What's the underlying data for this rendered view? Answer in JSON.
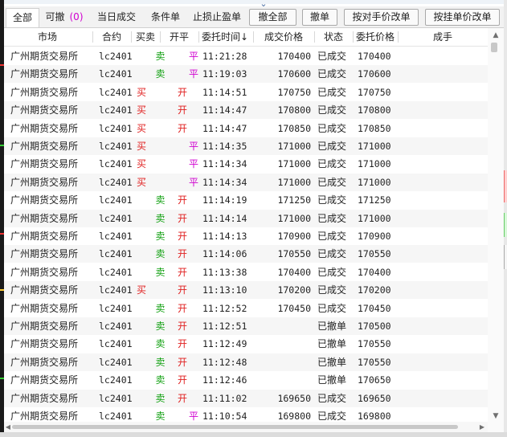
{
  "tabs": [
    {
      "label": "全部",
      "active": true
    },
    {
      "label": "可撤",
      "badge": "(0)",
      "active": false
    },
    {
      "label": "当日成交",
      "active": false
    },
    {
      "label": "条件单",
      "active": false
    },
    {
      "label": "止损止盈单",
      "active": false
    }
  ],
  "buttons": {
    "cancel_all": "撤全部",
    "cancel": "撤单",
    "modify_opposite": "按对手价改单",
    "modify_queue": "按挂单价改单"
  },
  "columns": {
    "market": "市场",
    "contract": "合约",
    "buy_sell": "买卖",
    "open_close": "开平",
    "order_time": "委托时间↓",
    "fill_price": "成交价格",
    "status": "状态",
    "order_price": "委托价格",
    "filled_lots": "成手"
  },
  "colors": {
    "buy": "#e02020",
    "sell": "#10a010",
    "open": "#e02020",
    "close": "#d000d0",
    "badge": "#d000d0"
  },
  "rows": [
    {
      "market": "广州期货交易所",
      "contract": "lc2401",
      "bs": "卖",
      "oc": "平",
      "time": "11:21:28",
      "fill_price": "170400",
      "status": "已成交",
      "order_price": "170400"
    },
    {
      "market": "广州期货交易所",
      "contract": "lc2401",
      "bs": "卖",
      "oc": "平",
      "time": "11:19:03",
      "fill_price": "170600",
      "status": "已成交",
      "order_price": "170600"
    },
    {
      "market": "广州期货交易所",
      "contract": "lc2401",
      "bs": "买",
      "oc": "开",
      "time": "11:14:51",
      "fill_price": "170750",
      "status": "已成交",
      "order_price": "170750"
    },
    {
      "market": "广州期货交易所",
      "contract": "lc2401",
      "bs": "买",
      "oc": "开",
      "time": "11:14:47",
      "fill_price": "170800",
      "status": "已成交",
      "order_price": "170800"
    },
    {
      "market": "广州期货交易所",
      "contract": "lc2401",
      "bs": "买",
      "oc": "开",
      "time": "11:14:47",
      "fill_price": "170850",
      "status": "已成交",
      "order_price": "170850"
    },
    {
      "market": "广州期货交易所",
      "contract": "lc2401",
      "bs": "买",
      "oc": "平",
      "time": "11:14:35",
      "fill_price": "171000",
      "status": "已成交",
      "order_price": "171000"
    },
    {
      "market": "广州期货交易所",
      "contract": "lc2401",
      "bs": "买",
      "oc": "平",
      "time": "11:14:34",
      "fill_price": "171000",
      "status": "已成交",
      "order_price": "171000"
    },
    {
      "market": "广州期货交易所",
      "contract": "lc2401",
      "bs": "买",
      "oc": "平",
      "time": "11:14:34",
      "fill_price": "171000",
      "status": "已成交",
      "order_price": "171000"
    },
    {
      "market": "广州期货交易所",
      "contract": "lc2401",
      "bs": "卖",
      "oc": "开",
      "time": "11:14:19",
      "fill_price": "171250",
      "status": "已成交",
      "order_price": "171250"
    },
    {
      "market": "广州期货交易所",
      "contract": "lc2401",
      "bs": "卖",
      "oc": "开",
      "time": "11:14:14",
      "fill_price": "171000",
      "status": "已成交",
      "order_price": "171000"
    },
    {
      "market": "广州期货交易所",
      "contract": "lc2401",
      "bs": "卖",
      "oc": "开",
      "time": "11:14:13",
      "fill_price": "170900",
      "status": "已成交",
      "order_price": "170900"
    },
    {
      "market": "广州期货交易所",
      "contract": "lc2401",
      "bs": "卖",
      "oc": "开",
      "time": "11:14:06",
      "fill_price": "170550",
      "status": "已成交",
      "order_price": "170550"
    },
    {
      "market": "广州期货交易所",
      "contract": "lc2401",
      "bs": "卖",
      "oc": "开",
      "time": "11:13:38",
      "fill_price": "170400",
      "status": "已成交",
      "order_price": "170400"
    },
    {
      "market": "广州期货交易所",
      "contract": "lc2401",
      "bs": "买",
      "oc": "开",
      "time": "11:13:10",
      "fill_price": "170200",
      "status": "已成交",
      "order_price": "170200"
    },
    {
      "market": "广州期货交易所",
      "contract": "lc2401",
      "bs": "卖",
      "oc": "开",
      "time": "11:12:52",
      "fill_price": "170450",
      "status": "已成交",
      "order_price": "170450"
    },
    {
      "market": "广州期货交易所",
      "contract": "lc2401",
      "bs": "卖",
      "oc": "开",
      "time": "11:12:51",
      "fill_price": "",
      "status": "已撤单",
      "order_price": "170500"
    },
    {
      "market": "广州期货交易所",
      "contract": "lc2401",
      "bs": "卖",
      "oc": "开",
      "time": "11:12:49",
      "fill_price": "",
      "status": "已撤单",
      "order_price": "170550"
    },
    {
      "market": "广州期货交易所",
      "contract": "lc2401",
      "bs": "卖",
      "oc": "开",
      "time": "11:12:48",
      "fill_price": "",
      "status": "已撤单",
      "order_price": "170550"
    },
    {
      "market": "广州期货交易所",
      "contract": "lc2401",
      "bs": "卖",
      "oc": "开",
      "time": "11:12:46",
      "fill_price": "",
      "status": "已撤单",
      "order_price": "170650"
    },
    {
      "market": "广州期货交易所",
      "contract": "lc2401",
      "bs": "卖",
      "oc": "开",
      "time": "11:11:02",
      "fill_price": "169650",
      "status": "已成交",
      "order_price": "169650"
    },
    {
      "market": "广州期货交易所",
      "contract": "lc2401",
      "bs": "卖",
      "oc": "平",
      "time": "11:10:54",
      "fill_price": "169800",
      "status": "已成交",
      "order_price": "169800"
    }
  ]
}
